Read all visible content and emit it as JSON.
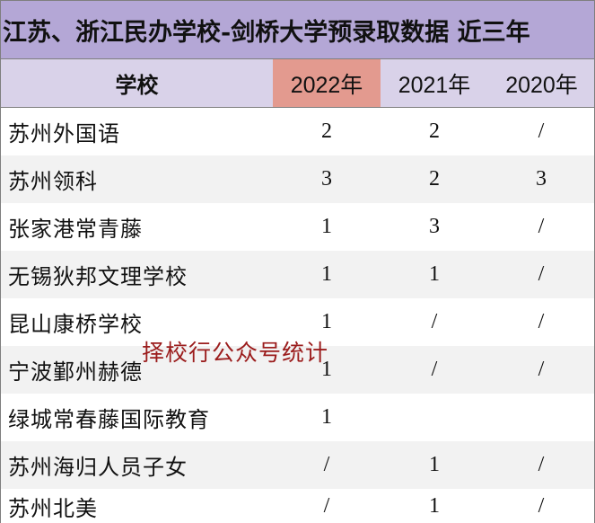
{
  "title": "江苏、浙江民办学校-剑桥大学预录取数据  近三年",
  "header": {
    "school": "学校",
    "y2022": "2022年",
    "y2021": "2021年",
    "y2020": "2020年"
  },
  "colors": {
    "title_bg": "#b4a7d6",
    "header_bg": "#d9d2e9",
    "highlight_2022": "#e39a8f",
    "watermark": "#9b1c1c"
  },
  "rows": [
    {
      "name": "苏州外国语",
      "y2022": "2",
      "y2021": "2",
      "y2020": "/"
    },
    {
      "name": "苏州领科",
      "y2022": "3",
      "y2021": "2",
      "y2020": "3"
    },
    {
      "name": "张家港常青藤",
      "y2022": "1",
      "y2021": "3",
      "y2020": "/"
    },
    {
      "name": "无锡狄邦文理学校",
      "y2022": "1",
      "y2021": "1",
      "y2020": "/"
    },
    {
      "name": "昆山康桥学校",
      "y2022": "1",
      "y2021": "/",
      "y2020": "/"
    },
    {
      "name": "宁波鄞州赫德",
      "y2022": "1",
      "y2021": "/",
      "y2020": "/"
    },
    {
      "name": "绿城常春藤国际教育",
      "y2022": "1",
      "y2021": "",
      "y2020": ""
    },
    {
      "name": "苏州海归人员子女",
      "y2022": "/",
      "y2021": "1",
      "y2020": "/"
    },
    {
      "name": "苏州北美",
      "y2022": "/",
      "y2021": "1",
      "y2020": "/"
    }
  ],
  "watermark": "择校行公众号统计"
}
